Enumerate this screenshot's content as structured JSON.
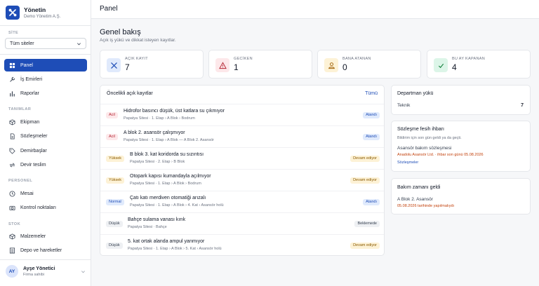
{
  "brand": {
    "title": "Yönetin",
    "subtitle": "Demo Yönetim A.Ş."
  },
  "sidebar": {
    "site_label": "SİTE",
    "site_select": "Tüm siteler",
    "nav_main": [
      {
        "label": "Panel",
        "icon": "home-icon",
        "active": true
      },
      {
        "label": "İş Emirleri",
        "icon": "wrench-icon"
      },
      {
        "label": "Raporlar",
        "icon": "bar-chart-icon"
      }
    ],
    "section_definitions": "TANIMLAR",
    "nav_definitions": [
      {
        "label": "Ekipman",
        "icon": "box-icon"
      },
      {
        "label": "Sözleşmeler",
        "icon": "document-icon"
      },
      {
        "label": "Demirbaşlar",
        "icon": "tag-icon"
      },
      {
        "label": "Devir teslim",
        "icon": "handover-icon"
      }
    ],
    "section_personnel": "PERSONEL",
    "nav_personnel": [
      {
        "label": "Mesai",
        "icon": "clock-icon"
      },
      {
        "label": "Kontrol noktaları",
        "icon": "camera-icon"
      }
    ],
    "section_stock": "STOK",
    "nav_stock": [
      {
        "label": "Malzemeler",
        "icon": "package-icon"
      },
      {
        "label": "Depo ve hareketler",
        "icon": "warehouse-icon"
      }
    ],
    "user": {
      "initials": "AY",
      "name": "Ayşe Yönetici",
      "role": "Firma sahibi"
    }
  },
  "topbar": {
    "title": "Panel"
  },
  "page": {
    "title": "Genel bakış",
    "subtitle": "Açık iş yükü ve dikkat isteyen kayıtlar."
  },
  "stats": [
    {
      "label": "AÇIK KAYIT",
      "value": "7",
      "icon": "wrench-icon",
      "color": "#e0eafc",
      "icon_color": "#1e4db7"
    },
    {
      "label": "GECİKEN",
      "value": "1",
      "icon": "alert-triangle-icon",
      "color": "#fde8ea",
      "icon_color": "#b42331"
    },
    {
      "label": "BANA ATANAN",
      "value": "0",
      "icon": "user-icon",
      "color": "#fdf2d6",
      "icon_color": "#a16207"
    },
    {
      "label": "BU AY KAPANAN",
      "value": "4",
      "icon": "check-icon",
      "color": "#dcf5e8",
      "icon_color": "#15803d"
    }
  ],
  "priority": {
    "title": "Öncelikli açık kayıtlar",
    "link": "Tümü",
    "rows": [
      {
        "badge": "Acil",
        "kind": "acil",
        "title": "Hidrofor basıncı düşük, üst katlara su çıkmıyor",
        "path": "Papatya Sitesi · 1. Etap › A Blok › Bodrum",
        "status": "Atandı",
        "skind": "atandi"
      },
      {
        "badge": "Acil",
        "kind": "acil",
        "title": "A blok 2. asansör çalışmıyor",
        "path": "Papatya Sitesi · 1. Etap › A Blok — A Blok 2. Asansör",
        "status": "Atandı",
        "skind": "atandi"
      },
      {
        "badge": "Yüksek",
        "kind": "yuksek",
        "title": "B blok 3. kat koridorda su sızıntısı",
        "path": "Papatya Sitesi · 2. Etap › B Blok",
        "status": "Devam ediyor",
        "skind": "devam"
      },
      {
        "badge": "Yüksek",
        "kind": "yuksek",
        "title": "Otopark kapısı kumandayla açılmıyor",
        "path": "Papatya Sitesi · 1. Etap › A Blok › Bodrum",
        "status": "Devam ediyor",
        "skind": "devam"
      },
      {
        "badge": "Normal",
        "kind": "normal",
        "title": "Çatı katı merdiven otomatiği arızalı",
        "path": "Papatya Sitesi · 1. Etap › A Blok › 4. Kat › Asansör holü",
        "status": "Atandı",
        "skind": "atandi"
      },
      {
        "badge": "Düşük",
        "kind": "dusuk",
        "title": "Bahçe sulama vanası kırık",
        "path": "Papatya Sitesi · Bahçe",
        "status": "Beklemede",
        "skind": "bekle"
      },
      {
        "badge": "Düşük",
        "kind": "dusuk",
        "title": "5. kat ortak alanda ampul yanmıyor",
        "path": "Papatya Sitesi · 1. Etap › A Blok › 5. Kat › Asansör holü",
        "status": "Devam ediyor",
        "skind": "devam"
      }
    ]
  },
  "department": {
    "title": "Departman yükü",
    "name": "Teknik",
    "count": "7"
  },
  "contract": {
    "title": "Sözleşme fesih ihbarı",
    "note": "Bildirim için son gün geldi ya da geçti.",
    "item": "Asansör bakım sözleşmesi",
    "detail": "Anadolu Asansör Ltd. · ihbar son günü 05.08.2026",
    "link": "Sözleşmeler"
  },
  "maintenance": {
    "title": "Bakım zamanı geldi",
    "item": "A Blok 2. Asansör",
    "detail": "05.08.2026 tarihinde yapılmalıydı"
  }
}
